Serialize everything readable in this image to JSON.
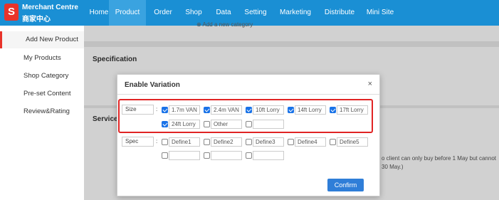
{
  "logo": {
    "badge": "S",
    "title_en": "Merchant Centre",
    "title_cn": "商家中心"
  },
  "nav": {
    "items": [
      "Home",
      "Product",
      "Order",
      "Shop",
      "Data",
      "Setting",
      "Marketing",
      "Distribute",
      "Mini Site"
    ],
    "active": "Product"
  },
  "sidebar": {
    "items": [
      "Add New Product",
      "My Products",
      "Shop Category",
      "Pre-set Content",
      "Review&Rating"
    ],
    "active": "Add New Product"
  },
  "background": {
    "add_category_text": "Add a new category",
    "specification_title": "Specification",
    "service_title": "Service S",
    "note_line1": "o client can only buy before 1 May but cannot",
    "note_line2": "30 May.)"
  },
  "modal": {
    "title": "Enable Variation",
    "close_label": "×",
    "size": {
      "label": "Size",
      "options": [
        {
          "value": "1.7m VAN",
          "checked": true
        },
        {
          "value": "2.4m VAN",
          "checked": true
        },
        {
          "value": "10ft Lorry",
          "checked": true
        },
        {
          "value": "14ft Lorry",
          "checked": true
        },
        {
          "value": "17ft Lorry",
          "checked": true
        },
        {
          "value": "24ft Lorry",
          "checked": true
        },
        {
          "value": "Other",
          "checked": false
        },
        {
          "value": "",
          "checked": false
        }
      ]
    },
    "spec": {
      "label": "Spec",
      "options": [
        {
          "value": "Define1",
          "checked": false
        },
        {
          "value": "Define2",
          "checked": false
        },
        {
          "value": "Define3",
          "checked": false
        },
        {
          "value": "Define4",
          "checked": false
        },
        {
          "value": "Define5",
          "checked": false
        },
        {
          "value": "",
          "checked": false
        },
        {
          "value": "",
          "checked": false
        },
        {
          "value": "",
          "checked": false
        }
      ]
    },
    "confirm_label": "Confirm"
  },
  "colors": {
    "nav_bg": "#1a8fd4",
    "accent_red": "#e02424",
    "confirm_bg": "#2f7ed8",
    "checkbox_checked": "#1a73e8"
  }
}
